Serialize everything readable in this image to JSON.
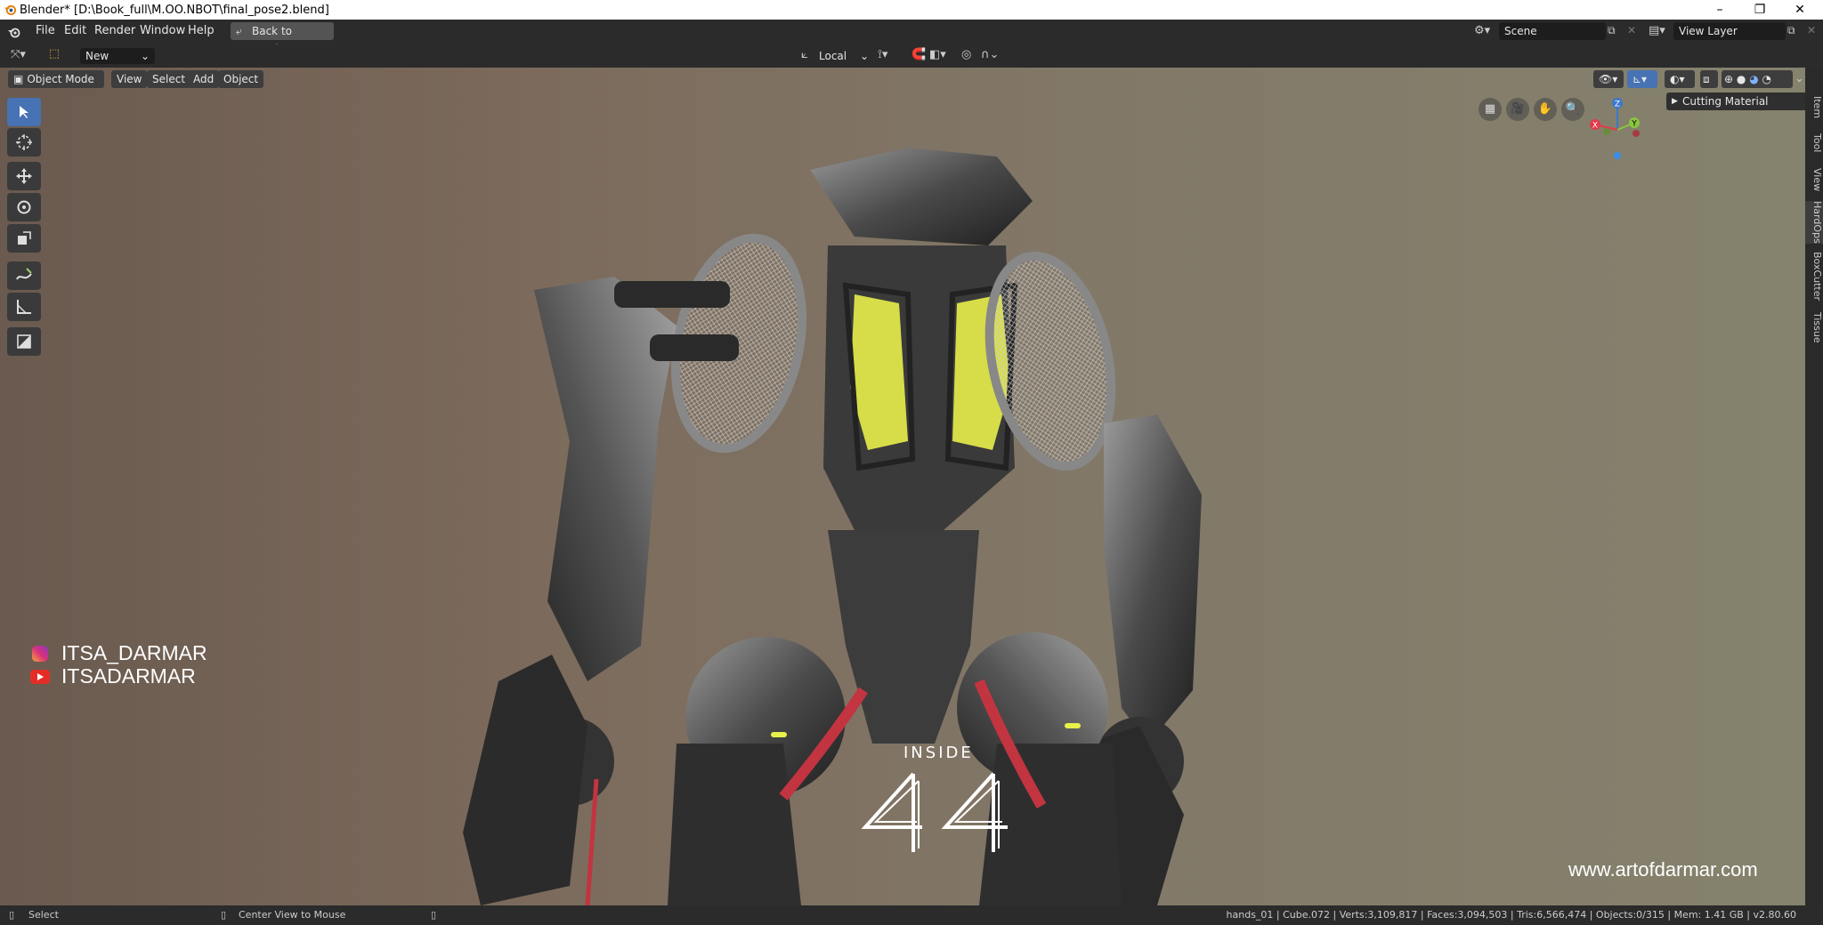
{
  "window": {
    "title": "Blender* [D:\\Book_full\\M.OO.NBOT\\final_pose2.blend]"
  },
  "topbar": {
    "menus": [
      "File",
      "Edit",
      "Render",
      "Window",
      "Help"
    ],
    "back_button": "Back to Previous",
    "scene_label": "Scene",
    "view_layer_label": "View Layer"
  },
  "tool_header": {
    "new_label": "New",
    "orientation": "Local"
  },
  "viewport_header": {
    "mode": "Object Mode",
    "menus": [
      "View",
      "Select",
      "Add",
      "Object"
    ]
  },
  "panel": {
    "cutting_material": "Cutting Material"
  },
  "gizmo": {
    "z": "Z",
    "y": "Y",
    "x": "X"
  },
  "sidebar_tabs": [
    "Item",
    "Tool",
    "View",
    "HardOps",
    "BoxCutter",
    "Tissue"
  ],
  "overlay": {
    "instagram": "ITSA_DARMAR",
    "youtube": "ITSADARMAR",
    "inside_label": "INSIDE",
    "website": "www.artofdarmar.com"
  },
  "statusbar": {
    "left_action": "Select",
    "middle_action": "Center View to Mouse",
    "stats": "hands_01 | Cube.072 | Verts:3,109,817 | Faces:3,094,503 | Tris:6,566,474 | Objects:0/315 | Mem: 1.41 GB | v2.80.60"
  },
  "colors": {
    "accent": "#4772b3",
    "header": "#2b2b2b",
    "gizmo_x": "#e33a4a",
    "gizmo_y": "#8bc53f",
    "gizmo_z": "#3a78c9",
    "emissive": "#e8f04a"
  }
}
